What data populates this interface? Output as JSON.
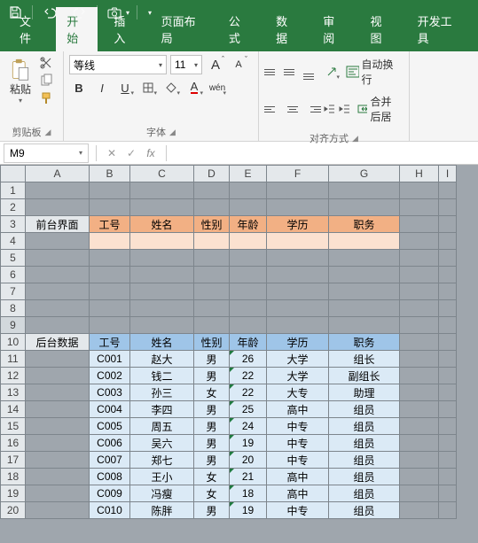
{
  "titlebar": {
    "save": "save",
    "undo": "undo",
    "redo": "redo",
    "camera": "camera"
  },
  "tabs": {
    "file": "文件",
    "home": "开始",
    "insert": "插入",
    "layout": "页面布局",
    "formula": "公式",
    "data": "数据",
    "review": "审阅",
    "view": "视图",
    "dev": "开发工具"
  },
  "ribbon": {
    "clipboard": {
      "paste": "粘贴",
      "label": "剪贴板"
    },
    "font": {
      "name": "等线",
      "size": "11",
      "bold": "B",
      "italic": "I",
      "underline": "U",
      "wen": "wén",
      "grow": "A",
      "shrink": "A",
      "label": "字体",
      "colorA": "A"
    },
    "align": {
      "wrap": "自动换行",
      "merge": "合并后居",
      "label": "对齐方式"
    }
  },
  "namebox": {
    "ref": "M9",
    "fx": "fx",
    "cancel": "✕",
    "confirm": "✓"
  },
  "columns": [
    "A",
    "B",
    "C",
    "D",
    "E",
    "F",
    "G",
    "H",
    "I"
  ],
  "rows_blank_top": [
    1,
    2
  ],
  "front": {
    "label": "前台界面",
    "headers": [
      "工号",
      "姓名",
      "性别",
      "年龄",
      "学历",
      "职务"
    ]
  },
  "rows_blank_mid": [
    5,
    6,
    7,
    8
  ],
  "back": {
    "label": "后台数据",
    "headers": [
      "工号",
      "姓名",
      "性别",
      "年龄",
      "学历",
      "职务"
    ]
  },
  "chart_data": {
    "type": "table",
    "columns": [
      "工号",
      "姓名",
      "性别",
      "年龄",
      "学历",
      "职务"
    ],
    "rows": [
      [
        "C001",
        "赵大",
        "男",
        26,
        "大学",
        "组长"
      ],
      [
        "C002",
        "钱二",
        "男",
        22,
        "大学",
        "副组长"
      ],
      [
        "C003",
        "孙三",
        "女",
        22,
        "大专",
        "助理"
      ],
      [
        "C004",
        "李四",
        "男",
        25,
        "高中",
        "组员"
      ],
      [
        "C005",
        "周五",
        "男",
        24,
        "中专",
        "组员"
      ],
      [
        "C006",
        "吴六",
        "男",
        19,
        "中专",
        "组员"
      ],
      [
        "C007",
        "郑七",
        "男",
        20,
        "中专",
        "组员"
      ],
      [
        "C008",
        "王小",
        "女",
        21,
        "高中",
        "组员"
      ],
      [
        "C009",
        "冯瘦",
        "女",
        18,
        "高中",
        "组员"
      ],
      [
        "C010",
        "陈胖",
        "男",
        19,
        "中专",
        "组员"
      ]
    ]
  }
}
